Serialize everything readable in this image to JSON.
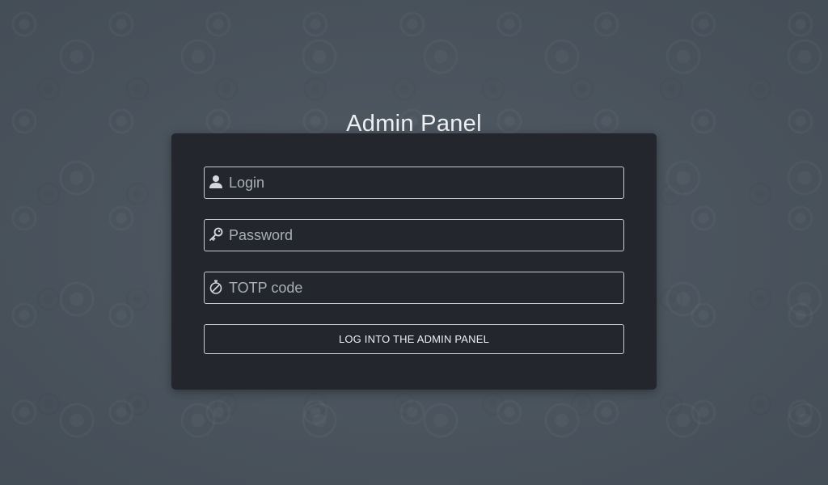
{
  "page": {
    "title": "Admin Panel"
  },
  "form": {
    "login": {
      "placeholder": "Login",
      "value": "",
      "icon": "user-icon"
    },
    "password": {
      "placeholder": "Password",
      "value": "",
      "icon": "key-icon"
    },
    "totp": {
      "placeholder": "TOTP code",
      "value": "",
      "icon": "stopwatch-icon"
    },
    "submit_label": "LOG INTO THE ADMIN PANEL"
  },
  "colors": {
    "background": "#4a545e",
    "card": "#23272d",
    "border": "#c9cdd2",
    "text": "#eef1f4",
    "placeholder": "#a9afb6"
  }
}
